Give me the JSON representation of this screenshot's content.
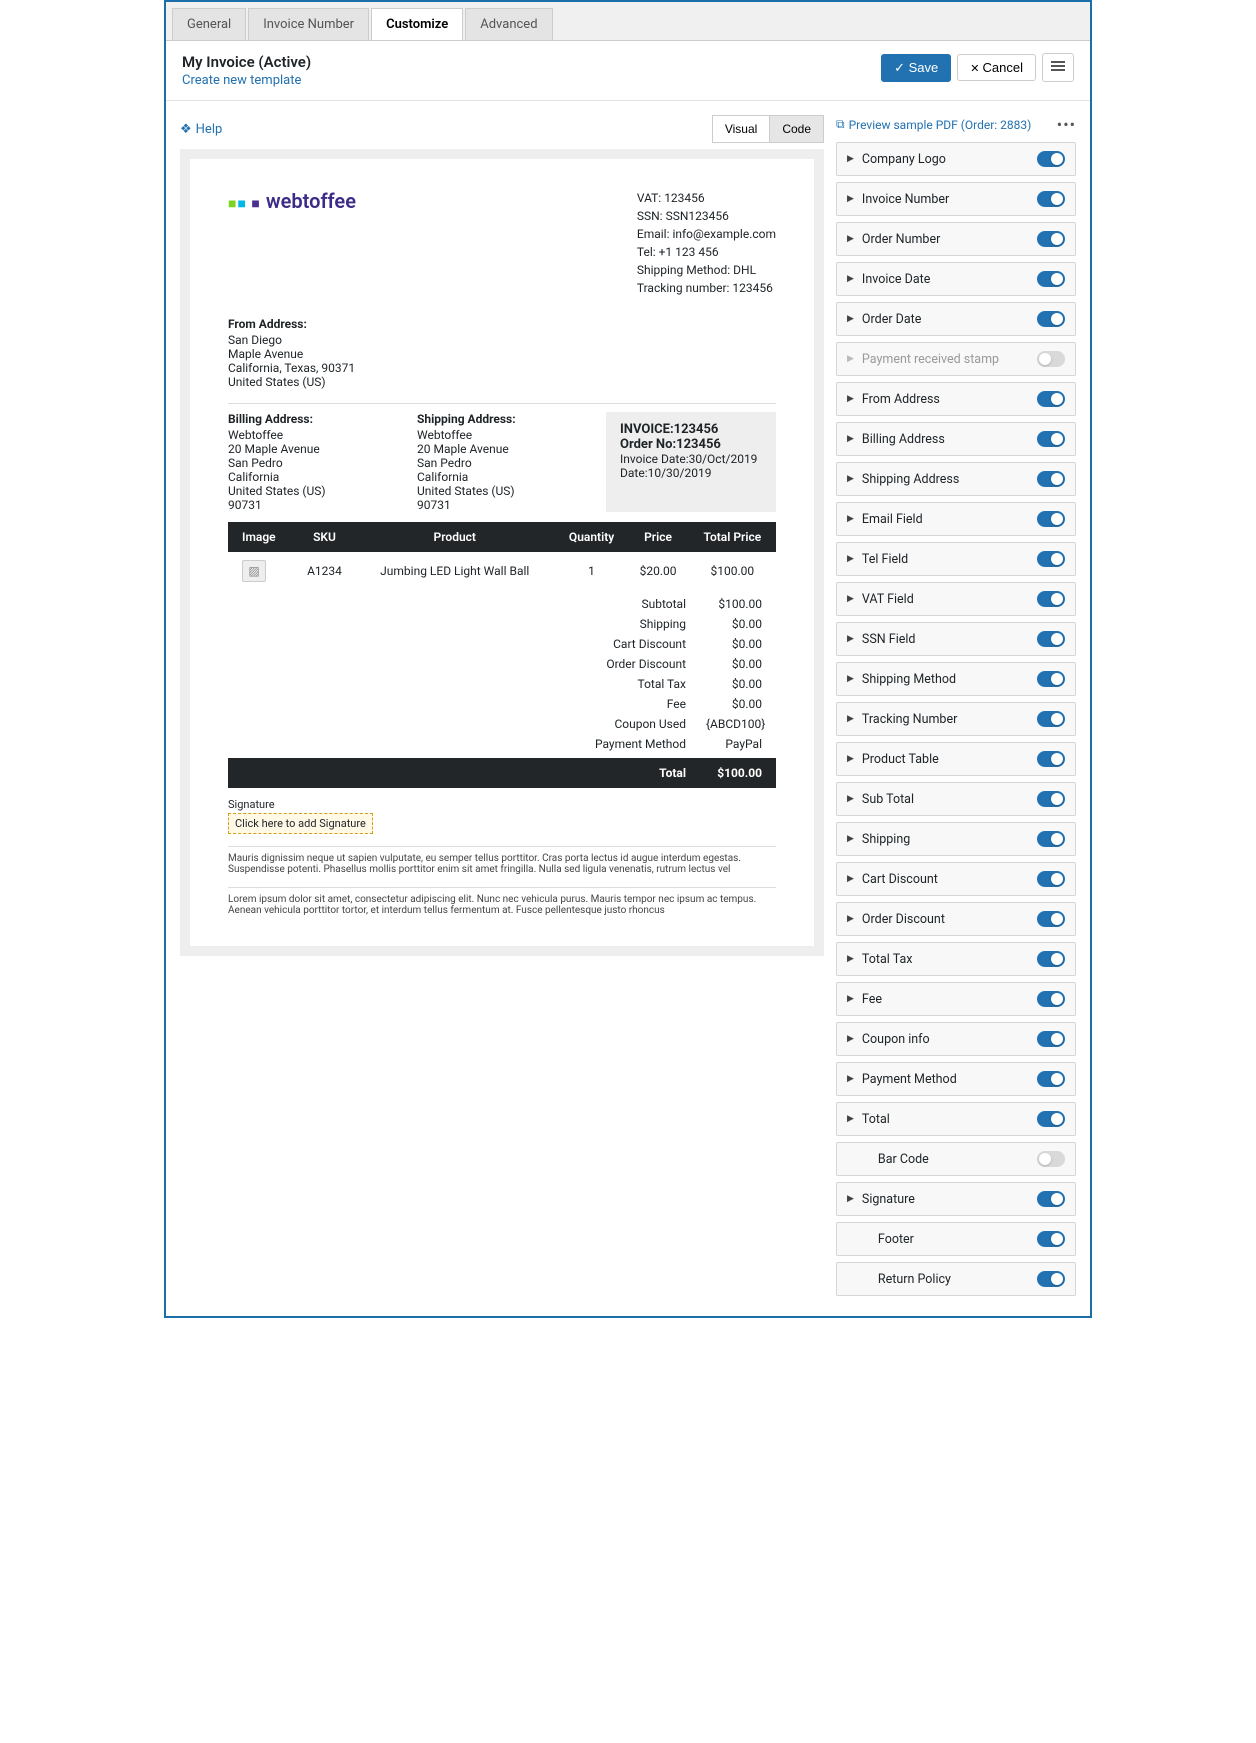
{
  "tabs": [
    "General",
    "Invoice Number",
    "Customize",
    "Advanced"
  ],
  "activeTab": 2,
  "header": {
    "title": "My Invoice (Active)",
    "createLink": "Create new template",
    "save": "Save",
    "cancel": "Cancel"
  },
  "help": "Help",
  "viewToggle": {
    "visual": "Visual",
    "code": "Code"
  },
  "preview": {
    "logoText": "webtoffee",
    "company": {
      "vat": "VAT: 123456",
      "ssn": "SSN: SSN123456",
      "email": "Email: info@example.com",
      "tel": "Tel: +1 123 456",
      "shipMethod": "Shipping Method: DHL",
      "tracking": "Tracking number: 123456"
    },
    "fromTitle": "From Address:",
    "fromLines": [
      "San Diego",
      "Maple Avenue",
      "California, Texas, 90371",
      "United States (US)"
    ],
    "billTitle": "Billing Address:",
    "billLines": [
      "Webtoffee",
      "20 Maple Avenue",
      "San Pedro",
      "California",
      "United States (US)",
      "90731"
    ],
    "shipTitle": "Shipping Address:",
    "shipLines": [
      "Webtoffee",
      "20 Maple Avenue",
      "San Pedro",
      "California",
      "United States (US)",
      "90731"
    ],
    "invoiceBox": {
      "l1": "INVOICE:123456",
      "l2": "Order No:123456",
      "l3": "Invoice Date:30/Oct/2019",
      "l4": "Date:10/30/2019"
    },
    "tableHead": [
      "Image",
      "SKU",
      "Product",
      "Quantity",
      "Price",
      "Total Price"
    ],
    "tableRow": {
      "sku": "A1234",
      "product": "Jumbing LED Light Wall Ball",
      "qty": "1",
      "price": "$20.00",
      "total": "$100.00"
    },
    "totals": [
      {
        "label": "Subtotal",
        "value": "$100.00"
      },
      {
        "label": "Shipping",
        "value": "$0.00"
      },
      {
        "label": "Cart Discount",
        "value": "$0.00"
      },
      {
        "label": "Order Discount",
        "value": "$0.00"
      },
      {
        "label": "Total Tax",
        "value": "$0.00"
      },
      {
        "label": "Fee",
        "value": "$0.00"
      },
      {
        "label": "Coupon Used",
        "value": "{ABCD100}"
      },
      {
        "label": "Payment Method",
        "value": "PayPal"
      }
    ],
    "finalLabel": "Total",
    "finalValue": "$100.00",
    "sigLabel": "Signature",
    "sigBox": "Click here to add Signature",
    "fine1": "Mauris dignissim neque ut sapien vulputate, eu semper tellus porttitor. Cras porta lectus id augue interdum egestas. Suspendisse potenti. Phasellus mollis porttitor enim sit amet fringilla. Nulla sed ligula venenatis, rutrum lectus vel",
    "fine2": "Lorem ipsum dolor sit amet, consectetur adipiscing elit. Nunc nec vehicula purus. Mauris tempor nec ipsum ac tempus. Aenean vehicula porttitor tortor, et interdum tellus fermentum at. Fusce pellentesque justo rhoncus"
  },
  "pdfLink": "Preview sample PDF (Order: 2883)",
  "panels": [
    {
      "label": "Company Logo",
      "on": true,
      "expand": true
    },
    {
      "label": "Invoice Number",
      "on": true,
      "expand": true
    },
    {
      "label": "Order Number",
      "on": true,
      "expand": true
    },
    {
      "label": "Invoice Date",
      "on": true,
      "expand": true
    },
    {
      "label": "Order Date",
      "on": true,
      "expand": true
    },
    {
      "label": "Payment received stamp",
      "on": false,
      "expand": true,
      "disabled": true
    },
    {
      "label": "From Address",
      "on": true,
      "expand": true
    },
    {
      "label": "Billing Address",
      "on": true,
      "expand": true
    },
    {
      "label": "Shipping Address",
      "on": true,
      "expand": true
    },
    {
      "label": "Email Field",
      "on": true,
      "expand": true
    },
    {
      "label": "Tel Field",
      "on": true,
      "expand": true
    },
    {
      "label": "VAT Field",
      "on": true,
      "expand": true
    },
    {
      "label": "SSN Field",
      "on": true,
      "expand": true
    },
    {
      "label": "Shipping Method",
      "on": true,
      "expand": true
    },
    {
      "label": "Tracking Number",
      "on": true,
      "expand": true
    },
    {
      "label": "Product Table",
      "on": true,
      "expand": true
    },
    {
      "label": "Sub Total",
      "on": true,
      "expand": true
    },
    {
      "label": "Shipping",
      "on": true,
      "expand": true
    },
    {
      "label": "Cart Discount",
      "on": true,
      "expand": true
    },
    {
      "label": "Order Discount",
      "on": true,
      "expand": true
    },
    {
      "label": "Total Tax",
      "on": true,
      "expand": true
    },
    {
      "label": "Fee",
      "on": true,
      "expand": true
    },
    {
      "label": "Coupon info",
      "on": true,
      "expand": true
    },
    {
      "label": "Payment Method",
      "on": true,
      "expand": true
    },
    {
      "label": "Total",
      "on": true,
      "expand": true
    },
    {
      "label": "Bar Code",
      "on": false,
      "expand": false
    },
    {
      "label": "Signature",
      "on": true,
      "expand": true
    },
    {
      "label": "Footer",
      "on": true,
      "expand": false
    },
    {
      "label": "Return Policy",
      "on": true,
      "expand": false
    }
  ]
}
